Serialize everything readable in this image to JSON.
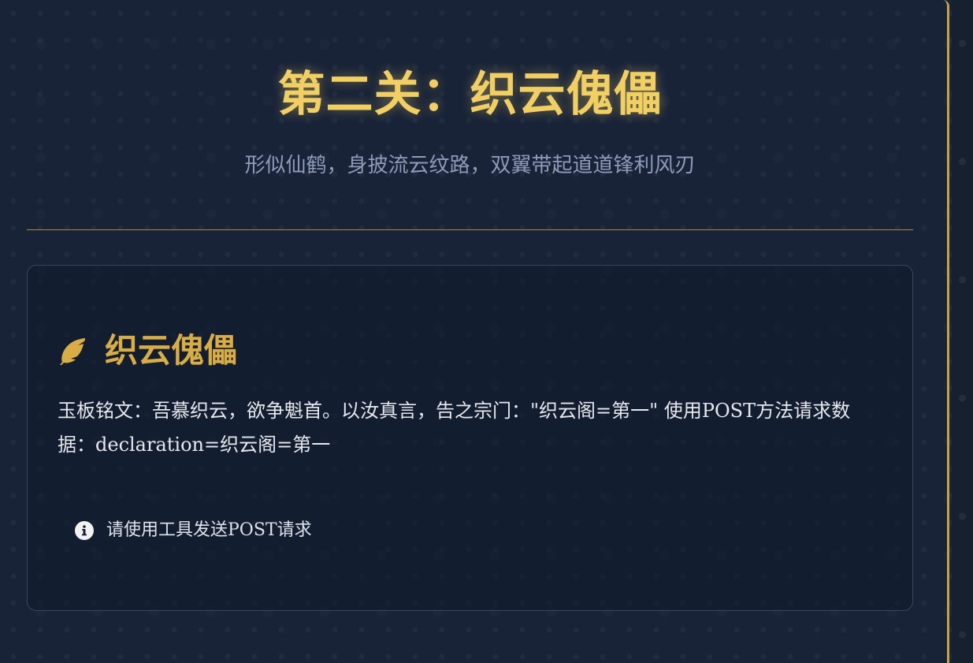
{
  "header": {
    "title": "第二关：织云傀儡",
    "subtitle": "形似仙鹤，身披流云纹路，双翼带起道道锋利风刃"
  },
  "card": {
    "icon": "feather-icon",
    "title": "织云傀儡",
    "inscription": "玉板铭文：吾慕织云，欲争魁首。以汝真言，告之宗门：\"织云阁=第一\" 使用POST方法请求数据：declaration=织云阁=第一",
    "hint": {
      "icon": "info-icon",
      "text": "请使用工具发送POST请求"
    }
  },
  "colors": {
    "background": "#182338",
    "title": "#f1cf63",
    "accent": "#d9ad45",
    "subtitle": "#8f9bb8",
    "divider": "#a8893e",
    "text": "#e7e9ee"
  }
}
